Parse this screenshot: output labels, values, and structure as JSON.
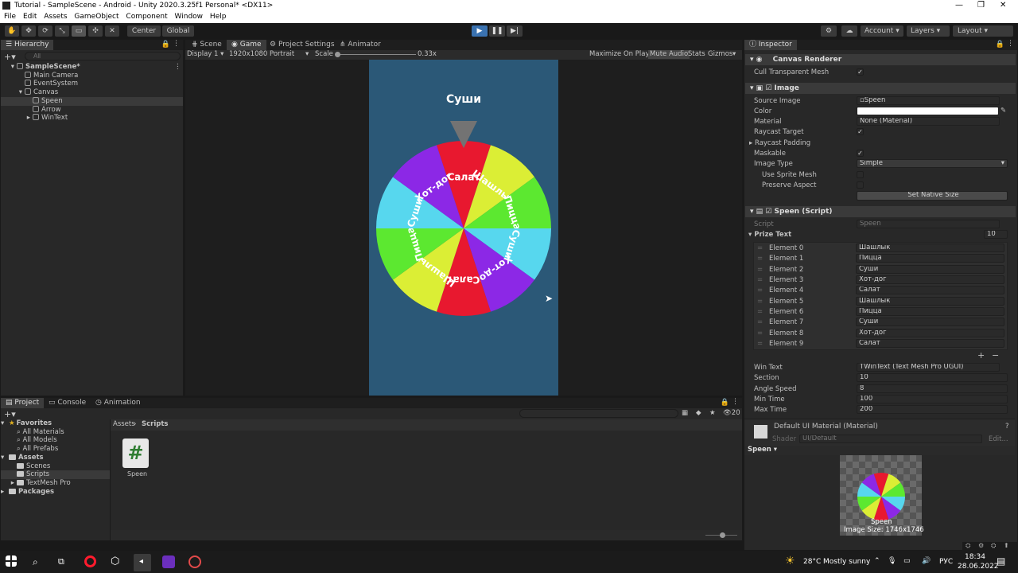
{
  "window": {
    "title": "Tutorial - SampleScene - Android - Unity 2020.3.25f1 Personal* <DX11>"
  },
  "menu": [
    "File",
    "Edit",
    "Assets",
    "GameObject",
    "Component",
    "Window",
    "Help"
  ],
  "toolbar": {
    "center_label": "Center",
    "global_label": "Global",
    "account": "Account",
    "layers": "Layers",
    "layout": "Layout"
  },
  "hierarchy": {
    "tab": "Hierarchy",
    "search_placeholder": "All",
    "items": [
      {
        "label": "SampleScene*",
        "indent": 0,
        "selected": false
      },
      {
        "label": "Main Camera",
        "indent": 1,
        "selected": false
      },
      {
        "label": "EventSystem",
        "indent": 1,
        "selected": false
      },
      {
        "label": "Canvas",
        "indent": 1,
        "selected": false
      },
      {
        "label": "Speen",
        "indent": 2,
        "selected": true
      },
      {
        "label": "Arrow",
        "indent": 2,
        "selected": false
      },
      {
        "label": "WinText",
        "indent": 2,
        "selected": false
      }
    ]
  },
  "center_tabs": {
    "scene": "Scene",
    "game": "Game",
    "project_settings": "Project Settings",
    "animator": "Animator"
  },
  "game_bar": {
    "display": "Display 1",
    "resolution": "1920x1080 Portrait",
    "scale_label": "Scale",
    "scale_value": "0.33x",
    "maximize": "Maximize On Play",
    "mute": "Mute Audio",
    "stats": "Stats",
    "gizmos": "Gizmos"
  },
  "game": {
    "title": "Суши",
    "sectors": [
      "Салат",
      "Шашлык",
      "Пицца",
      "Суши",
      "Хот-дог",
      "Салат",
      "Шашлык",
      "Пицца",
      "Суши",
      "Хот-дог"
    ],
    "sector_colors": [
      "#e8182f",
      "#dbee35",
      "#5ce830",
      "#57d7ee",
      "#8c28e6",
      "#e8182f",
      "#dbee35",
      "#5ce830",
      "#57d7ee",
      "#8c28e6"
    ]
  },
  "inspector": {
    "tab": "Inspector",
    "canvas_renderer": {
      "title": "Canvas Renderer",
      "cull_label": "Cull Transparent Mesh"
    },
    "image": {
      "title": "Image",
      "source_image_label": "Source Image",
      "source_image_value": "Speen",
      "color_label": "Color",
      "material_label": "Material",
      "material_value": "None (Material)",
      "raycast_target_label": "Raycast Target",
      "raycast_padding_label": "Raycast Padding",
      "maskable_label": "Maskable",
      "image_type_label": "Image Type",
      "image_type_value": "Simple",
      "use_sprite_mesh_label": "Use Sprite Mesh",
      "preserve_aspect_label": "Preserve Aspect",
      "set_native_size": "Set Native Size"
    },
    "script": {
      "title": "Speen (Script)",
      "script_label": "Script",
      "script_value": "Speen",
      "prize_text_label": "Prize Text",
      "prize_text_count": "10",
      "elements": [
        {
          "label": "Element 0",
          "value": "Шашлык"
        },
        {
          "label": "Element 1",
          "value": "Пицца"
        },
        {
          "label": "Element 2",
          "value": "Суши"
        },
        {
          "label": "Element 3",
          "value": "Хот-дог"
        },
        {
          "label": "Element 4",
          "value": "Салат"
        },
        {
          "label": "Element 5",
          "value": "Шашлык"
        },
        {
          "label": "Element 6",
          "value": "Пицца"
        },
        {
          "label": "Element 7",
          "value": "Суши"
        },
        {
          "label": "Element 8",
          "value": "Хот-дог"
        },
        {
          "label": "Element 9",
          "value": "Салат"
        }
      ],
      "win_text_label": "Win Text",
      "win_text_value": "WinText (Text Mesh Pro UGUI)",
      "section_label": "Section",
      "section_value": "10",
      "angle_speed_label": "Angle Speed",
      "angle_speed_value": "8",
      "min_time_label": "Min Time",
      "min_time_value": "100",
      "max_time_label": "Max Time",
      "max_time_value": "200"
    },
    "material": {
      "title": "Default UI Material (Material)",
      "shader_label": "Shader",
      "shader_value": "UI/Default",
      "edit": "Edit..."
    },
    "preview": {
      "dropdown": "Speen",
      "name": "Speen",
      "size": "Image Size: 1746x1746"
    }
  },
  "project": {
    "tabs": {
      "project": "Project",
      "console": "Console",
      "animation": "Animation"
    },
    "tree": [
      {
        "label": "Favorites",
        "kind": "fav",
        "indent": 0
      },
      {
        "label": "All Materials",
        "kind": "search",
        "indent": 1
      },
      {
        "label": "All Models",
        "kind": "search",
        "indent": 1
      },
      {
        "label": "All Prefabs",
        "kind": "search",
        "indent": 1
      },
      {
        "label": "Assets",
        "kind": "folder",
        "indent": 0
      },
      {
        "label": "Scenes",
        "kind": "folder",
        "indent": 1
      },
      {
        "label": "Scripts",
        "kind": "folder",
        "indent": 1,
        "selected": true
      },
      {
        "label": "TextMesh Pro",
        "kind": "folder",
        "indent": 1
      },
      {
        "label": "Packages",
        "kind": "folder",
        "indent": 0
      }
    ],
    "breadcrumb_root": "Assets",
    "breadcrumb_current": "Scripts",
    "asset_name": "Speen",
    "hidden_count": "20"
  },
  "taskbar": {
    "weather_temp": "28°C",
    "weather_desc": "Mostly sunny",
    "lang": "РУС",
    "time": "18:34",
    "date": "28.06.2022"
  }
}
